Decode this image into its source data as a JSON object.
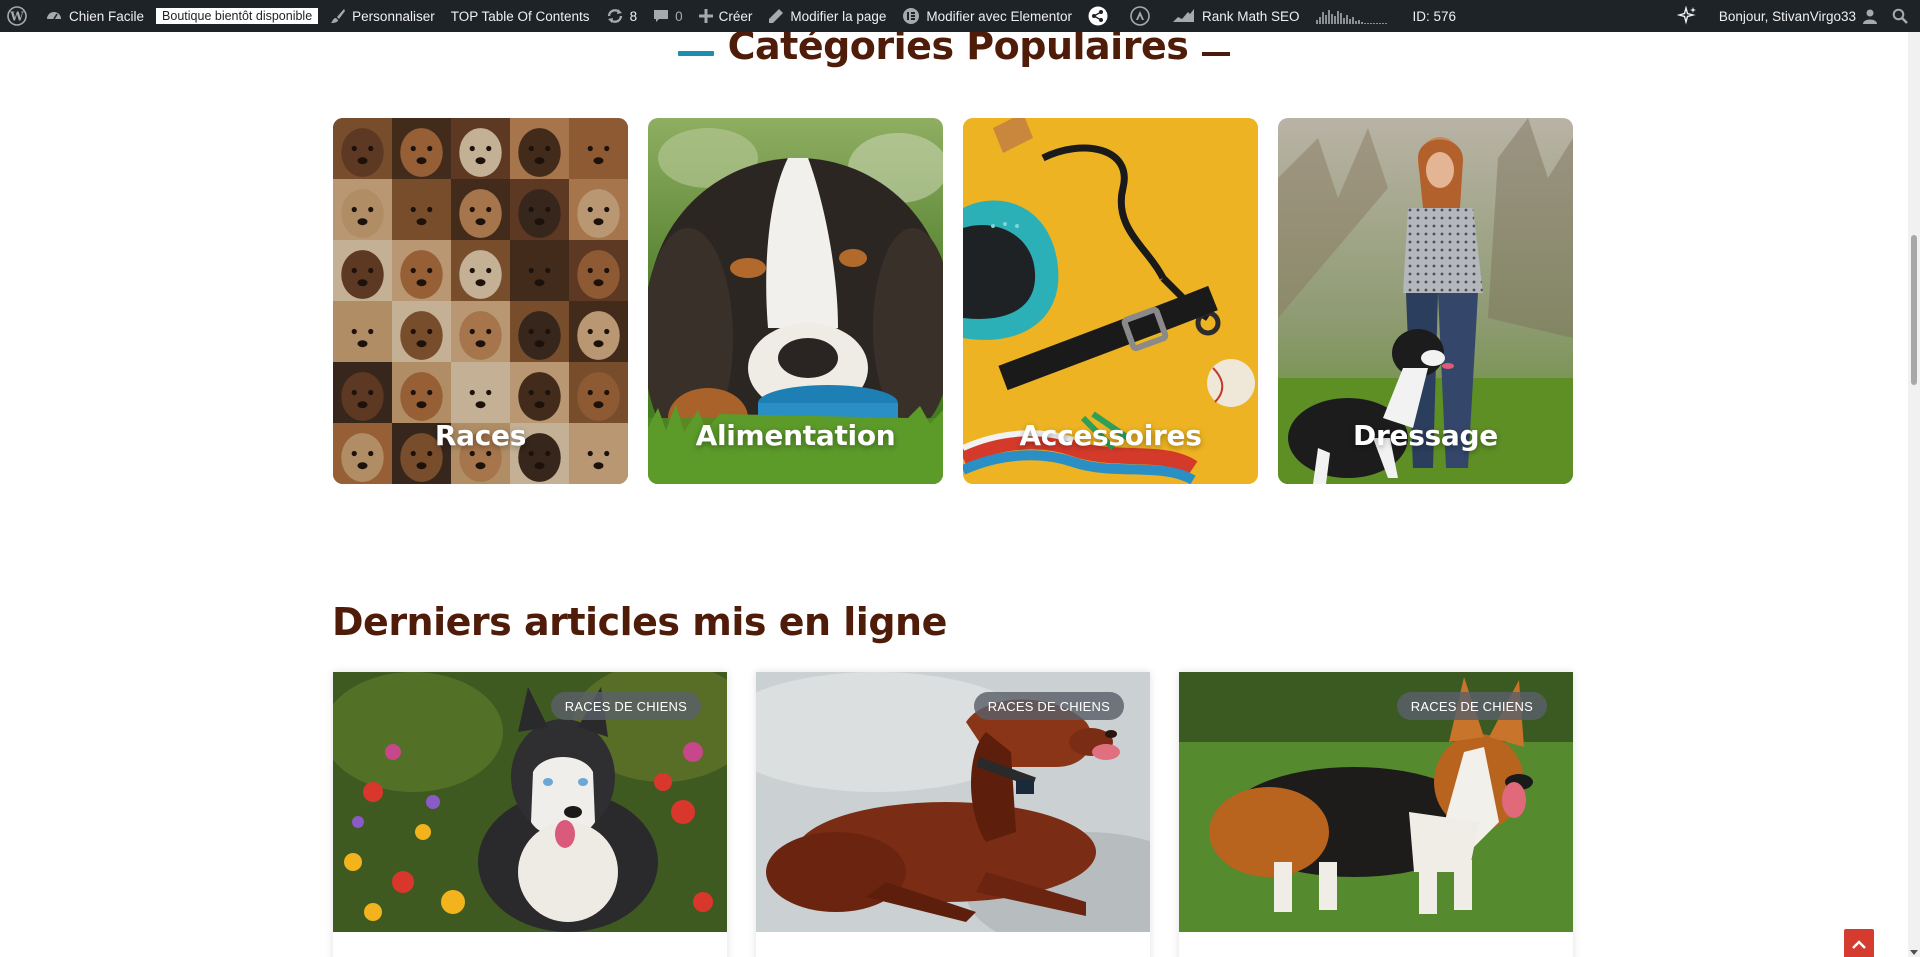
{
  "admin_bar": {
    "site_name": "Chien Facile",
    "store_badge": "Boutique bientôt disponible",
    "customize": "Personnaliser",
    "toc": "TOP Table Of Contents",
    "updates_count": "8",
    "comments_count": "0",
    "create": "Créer",
    "edit_page": "Modifier la page",
    "edit_elementor": "Modifier avec Elementor",
    "rank_math": "Rank Math SEO",
    "page_id": "ID: 576",
    "greeting": "Bonjour, StivanVirgo33"
  },
  "categories_section": {
    "title": "Catégories Populaires",
    "items": [
      {
        "label": "Races"
      },
      {
        "label": "Alimentation"
      },
      {
        "label": "Accessoires"
      },
      {
        "label": "Dressage"
      }
    ]
  },
  "latest_section": {
    "title": "Derniers articles mis en ligne",
    "posts": [
      {
        "tag": "RACES DE CHIENS"
      },
      {
        "tag": "RACES DE CHIENS"
      },
      {
        "tag": "RACES DE CHIENS"
      }
    ]
  },
  "colors": {
    "heading": "#4e1c08",
    "accent_blue": "#1a8fb0",
    "admin_bar": "#1d2327",
    "back_to_top": "#d63b2f"
  },
  "icons": [
    "wordpress-icon",
    "dashboard-icon",
    "brush-icon",
    "updates-icon",
    "comment-icon",
    "plus-icon",
    "pencil-icon",
    "elementor-icon",
    "share-icon",
    "astra-icon",
    "rank-math-icon",
    "ai-sparkle-icon",
    "user-icon",
    "search-icon",
    "arrow-up-icon"
  ]
}
